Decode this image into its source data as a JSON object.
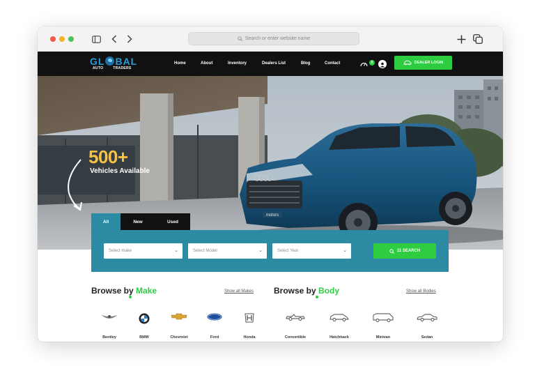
{
  "browser": {
    "address_placeholder": "Search or enter website name"
  },
  "site": {
    "logo_main_left": "GL",
    "logo_main_right": "BAL",
    "logo_sub_left": "AUTO",
    "logo_sub_right": "TRADERS",
    "nav": [
      "Home",
      "About",
      "Inventory",
      "Dealers List",
      "Blog",
      "Contact"
    ],
    "notification_count": "0",
    "dealer_login": "DEALER LOGIN",
    "accent_color": "#2ecc40",
    "panel_color": "#2c8aa3"
  },
  "hero": {
    "count": "500+",
    "count_label": "Vehicles Available",
    "plate_text": "motors"
  },
  "search": {
    "tabs": [
      "All",
      "New",
      "Used"
    ],
    "make_placeholder": "Select make",
    "model_placeholder": "Select Model",
    "year_placeholder": "Select Year",
    "button": "11 SEARCH"
  },
  "browse_make": {
    "title_prefix": "Browse by",
    "title_accent": "Make",
    "show_all": "Show all Makes",
    "brands": [
      "Bentley",
      "BMW",
      "Chevrolet",
      "Ford",
      "Honda"
    ]
  },
  "browse_body": {
    "title_prefix": "Browse by",
    "title_accent": "Body",
    "show_all": "Show all Bodies",
    "bodies": [
      "Convertible",
      "Hatchback",
      "Minivan",
      "Sedan"
    ]
  }
}
